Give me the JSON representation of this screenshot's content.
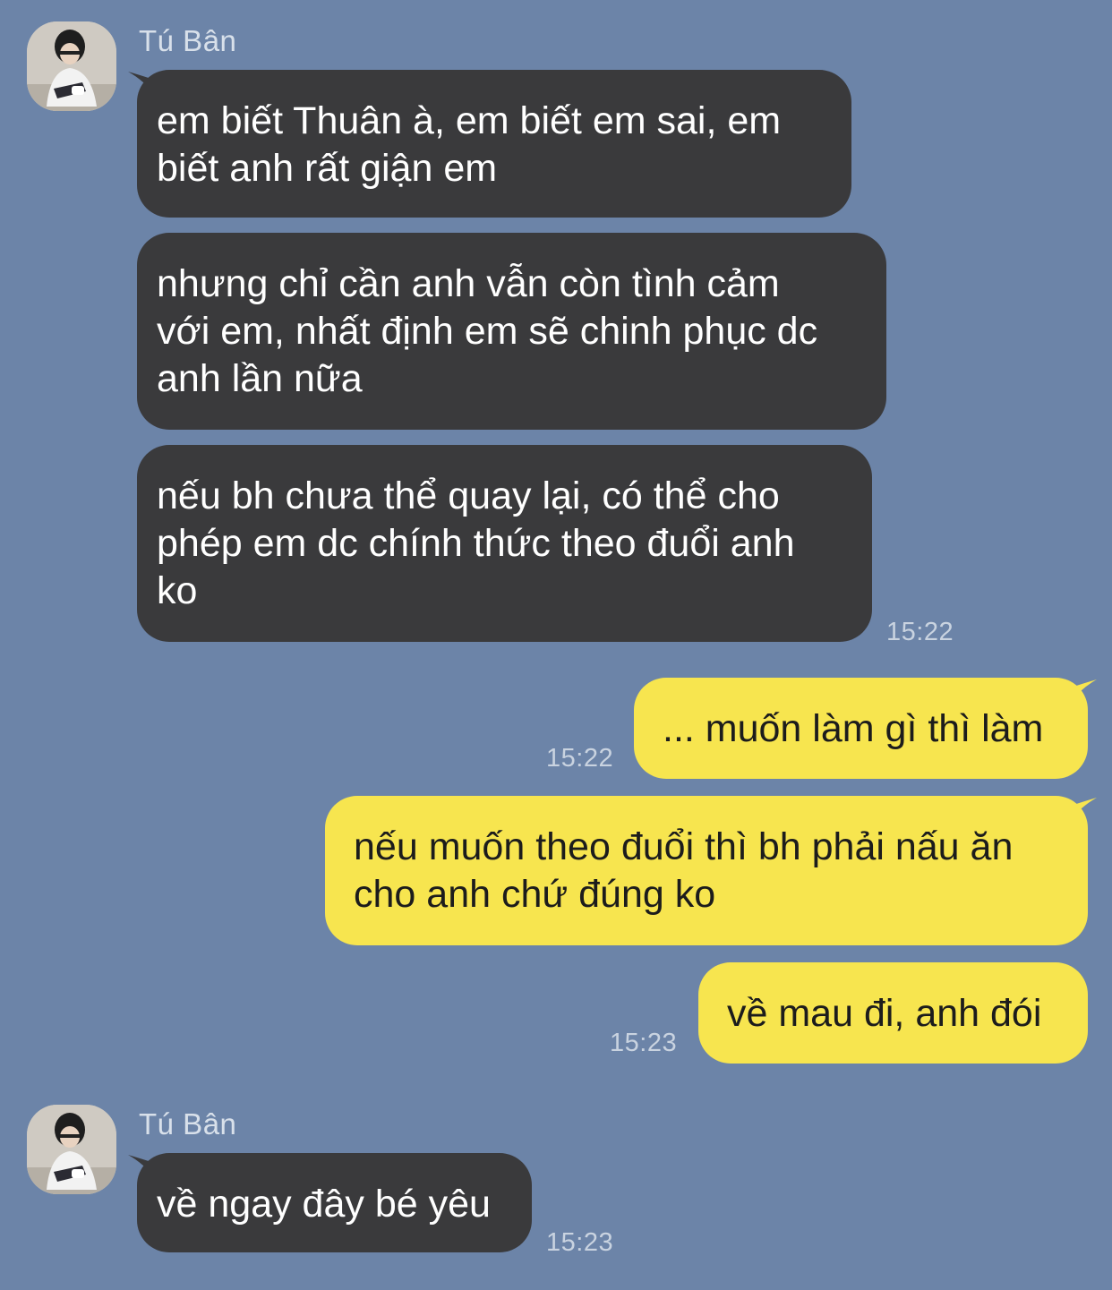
{
  "chat": {
    "groups": [
      {
        "sender": "Tú Bân",
        "messages": [
          "em biết Thuân à, em biết em sai, em\nbiết anh rất giận em",
          "nhưng chỉ cần anh vẫn còn tình cảm\nvới em, nhất định em sẽ chinh phục dc\nanh lần nữa",
          "nếu bh chưa thể quay lại, có thể cho\nphép em dc chính thức theo đuổi anh\nko"
        ],
        "time": "15:22"
      },
      {
        "sender": "me",
        "messages": [
          "... muốn làm gì thì làm"
        ],
        "time": "15:22"
      },
      {
        "sender": "me",
        "messages": [
          "nếu muốn theo đuổi thì bh phải nấu ăn\ncho anh chứ đúng ko",
          "về mau đi, anh đói"
        ],
        "time": "15:23"
      },
      {
        "sender": "Tú Bân",
        "messages": [
          "về ngay đây bé yêu"
        ],
        "time": "15:23"
      }
    ]
  },
  "colors": {
    "background": "#6c84a8",
    "incoming_bubble": "#3a3a3c",
    "outgoing_bubble": "#f7e54f",
    "timestamp": "#c9d3e0"
  },
  "icons": {
    "avatar": "contact-photo"
  }
}
